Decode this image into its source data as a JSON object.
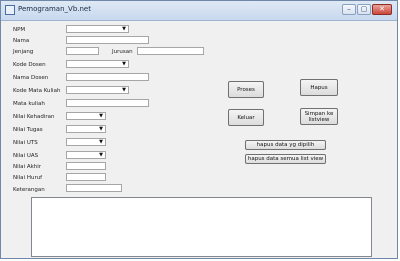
{
  "window": {
    "title": "Pemograman_Vb.net",
    "icon": "window-app-icon",
    "controls": {
      "minimize": "–",
      "maximize": "▢",
      "close": "✕"
    }
  },
  "form": {
    "npm_label": "NPM",
    "nama_label": "Nama",
    "jenjang_label": "Jenjang",
    "jurusan_label": "Jurusan",
    "kode_dosen_label": "Kode Dosen",
    "nama_dosen_label": "Nama Dosen",
    "kode_mata_kuliah_label": "Kode Mata Kuliah",
    "mata_kuliah_label": "Mata kuliah",
    "nilai_kehadiran_label": "Nilai Kehadiran",
    "nilai_tugas_label": "Nilai Tugas",
    "nilai_uts_label": "Nilai UTS",
    "nilai_uas_label": "Nilai UAS",
    "nilai_akhir_label": "Nilai Akhir",
    "nilai_huruf_label": "Nilai Huruf",
    "keterangan_label": "Keterangan"
  },
  "buttons": {
    "proses": "Proses",
    "hapus": "Hapus",
    "keluar": "Keluar",
    "simpan": "Simpan ke listview",
    "hapus_dipilih": "hapus data yg dipilih",
    "hapus_semua": "hapus data semua list view"
  }
}
